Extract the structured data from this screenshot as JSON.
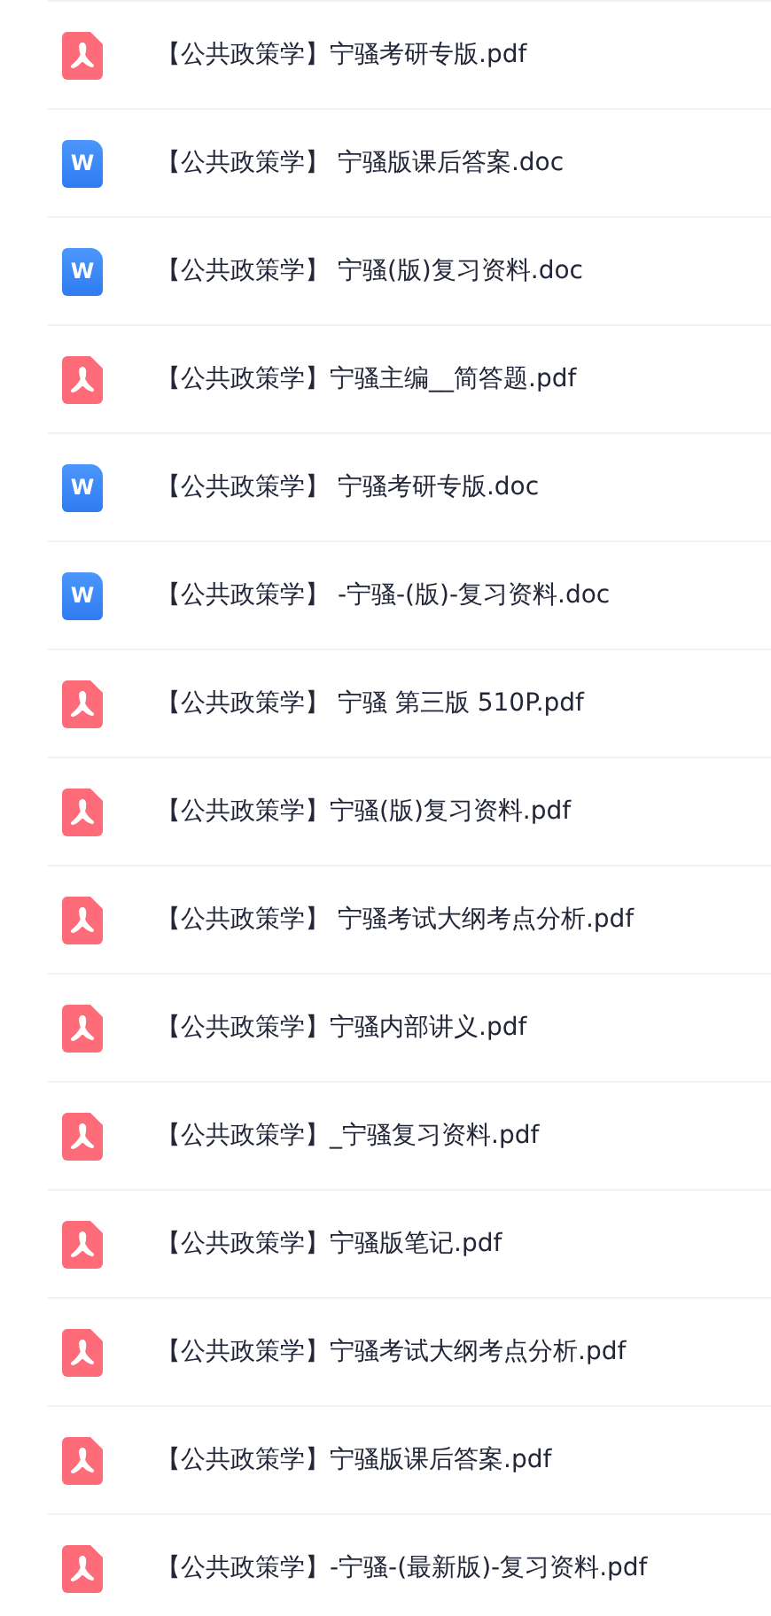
{
  "files": [
    {
      "kind": "pdf",
      "name": "【公共政策学】宁骚考研专版.pdf"
    },
    {
      "kind": "doc",
      "icon_letter": "W",
      "name": "【公共政策学】 宁骚版课后答案.doc"
    },
    {
      "kind": "doc",
      "icon_letter": "W",
      "name": "【公共政策学】 宁骚(版)复习资料.doc"
    },
    {
      "kind": "pdf",
      "name": "【公共政策学】宁骚主编__简答题.pdf"
    },
    {
      "kind": "doc",
      "icon_letter": "W",
      "name": "【公共政策学】 宁骚考研专版.doc"
    },
    {
      "kind": "doc",
      "icon_letter": "W",
      "name": "【公共政策学】 -宁骚-(版)-复习资料.doc"
    },
    {
      "kind": "pdf",
      "name": "【公共政策学】 宁骚 第三版 510P.pdf"
    },
    {
      "kind": "pdf",
      "name": "【公共政策学】宁骚(版)复习资料.pdf"
    },
    {
      "kind": "pdf",
      "name": "【公共政策学】 宁骚考试大纲考点分析.pdf"
    },
    {
      "kind": "pdf",
      "name": "【公共政策学】宁骚内部讲义.pdf"
    },
    {
      "kind": "pdf",
      "name": "【公共政策学】_宁骚复习资料.pdf"
    },
    {
      "kind": "pdf",
      "name": "【公共政策学】宁骚版笔记.pdf"
    },
    {
      "kind": "pdf",
      "name": "【公共政策学】宁骚考试大纲考点分析.pdf"
    },
    {
      "kind": "pdf",
      "name": "【公共政策学】宁骚版课后答案.pdf"
    },
    {
      "kind": "pdf",
      "name": "【公共政策学】-宁骚-(最新版)-复习资料.pdf"
    }
  ]
}
